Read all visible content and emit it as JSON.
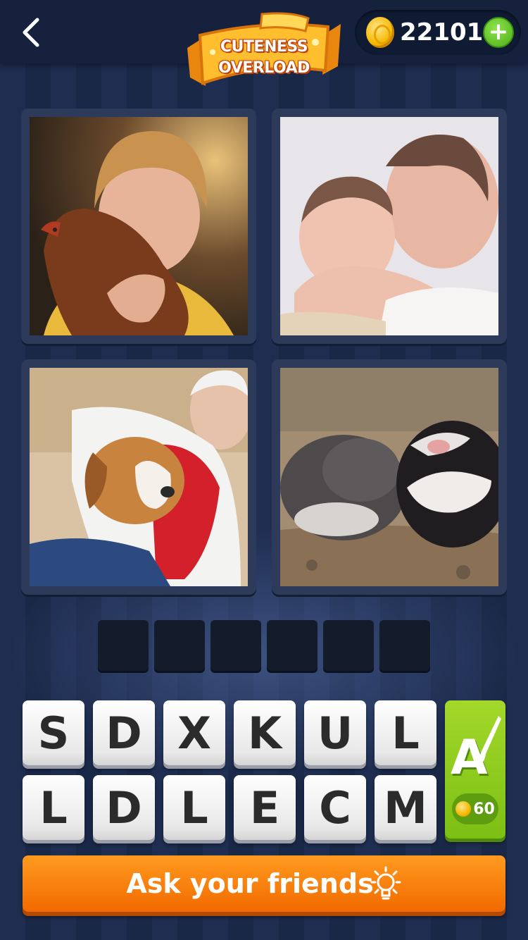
{
  "header": {
    "banner_line1": "CUTENESS",
    "banner_line2": "OVERLOAD",
    "coins": "22101"
  },
  "puzzle": {
    "photos": [
      {
        "icon": "photo-boy-hugging-hen"
      },
      {
        "icon": "photo-two-newborn-babies"
      },
      {
        "icon": "photo-woman-hugging-beagle"
      },
      {
        "icon": "photo-two-penguins"
      }
    ],
    "answer_length": 6,
    "letters_row1": [
      "S",
      "D",
      "X",
      "K",
      "U",
      "L"
    ],
    "letters_row2": [
      "L",
      "D",
      "L",
      "E",
      "C",
      "M"
    ]
  },
  "hint": {
    "letter": "A",
    "price": "60"
  },
  "ask_button": {
    "label": "Ask your friends"
  },
  "colors": {
    "background": "#1b2a4b",
    "ask_button": "#f26a00",
    "hint_button": "#7cbf14",
    "coin": "#f5b800"
  }
}
